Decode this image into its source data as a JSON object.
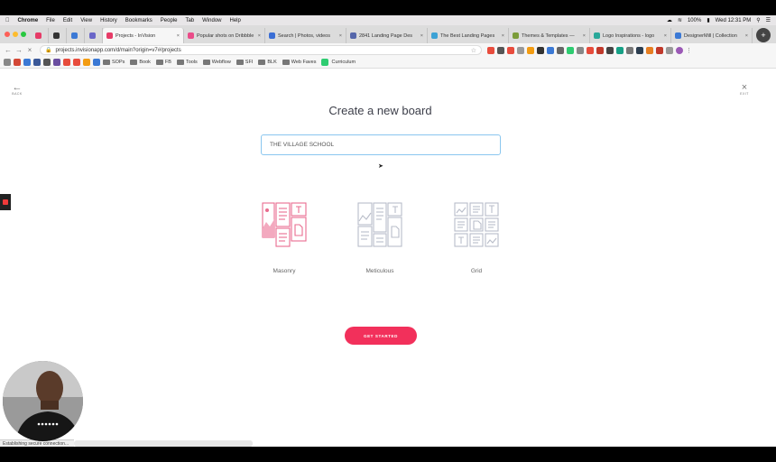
{
  "menubar": {
    "items": [
      "Chrome",
      "File",
      "Edit",
      "View",
      "History",
      "Bookmarks",
      "People",
      "Tab",
      "Window",
      "Help"
    ],
    "battery": "100%",
    "clock": "Wed 12:31 PM"
  },
  "tabs": [
    {
      "title": "Projects - InVision",
      "color": "#e63b67",
      "active": true
    },
    {
      "title": "Popular shots on Dribbble",
      "color": "#ea4c89",
      "active": false
    },
    {
      "title": "Search | Photos, videos",
      "color": "#3b6ed5",
      "active": false
    },
    {
      "title": "2841 Landing Page Des",
      "color": "#5566aa",
      "active": false
    },
    {
      "title": "The Best Landing Pages",
      "color": "#3da2d5",
      "active": false
    },
    {
      "title": "Themes & Templates —",
      "color": "#7b9c3a",
      "active": false
    },
    {
      "title": "Logo Inspirations - logo",
      "color": "#2aa89a",
      "active": false
    },
    {
      "title": "DesignerMill | Collection",
      "color": "#3b79d5",
      "active": false
    }
  ],
  "address": {
    "url": "projects.invisionapp.com/d/main?origin=v7#/projects"
  },
  "bookmarks": [
    {
      "type": "folder",
      "label": "SOPs"
    },
    {
      "type": "folder",
      "label": "Book"
    },
    {
      "type": "folder",
      "label": "FB"
    },
    {
      "type": "folder",
      "label": "Tools"
    },
    {
      "type": "folder",
      "label": "Webflow"
    },
    {
      "type": "folder",
      "label": "SFI"
    },
    {
      "type": "folder",
      "label": "BLK"
    },
    {
      "type": "folder",
      "label": "Web Faves"
    },
    {
      "type": "site",
      "label": "Curriculum"
    }
  ],
  "page": {
    "back_label": "BACK",
    "exit_label": "EXIT",
    "heading": "Create a new board",
    "board_name_value": "THE VILLAGE SCHOOL",
    "layouts": [
      {
        "name": "Masonry",
        "selected": true
      },
      {
        "name": "Meticulous",
        "selected": false
      },
      {
        "name": "Grid",
        "selected": false
      }
    ],
    "cta": "GET STARTED"
  },
  "status_text": "Establishing secure connection...",
  "colors": {
    "accent": "#f2305b",
    "selected_layout": "#e96c8f",
    "unselected_layout": "#b9bdc9",
    "input_border": "#8ac6ef"
  }
}
